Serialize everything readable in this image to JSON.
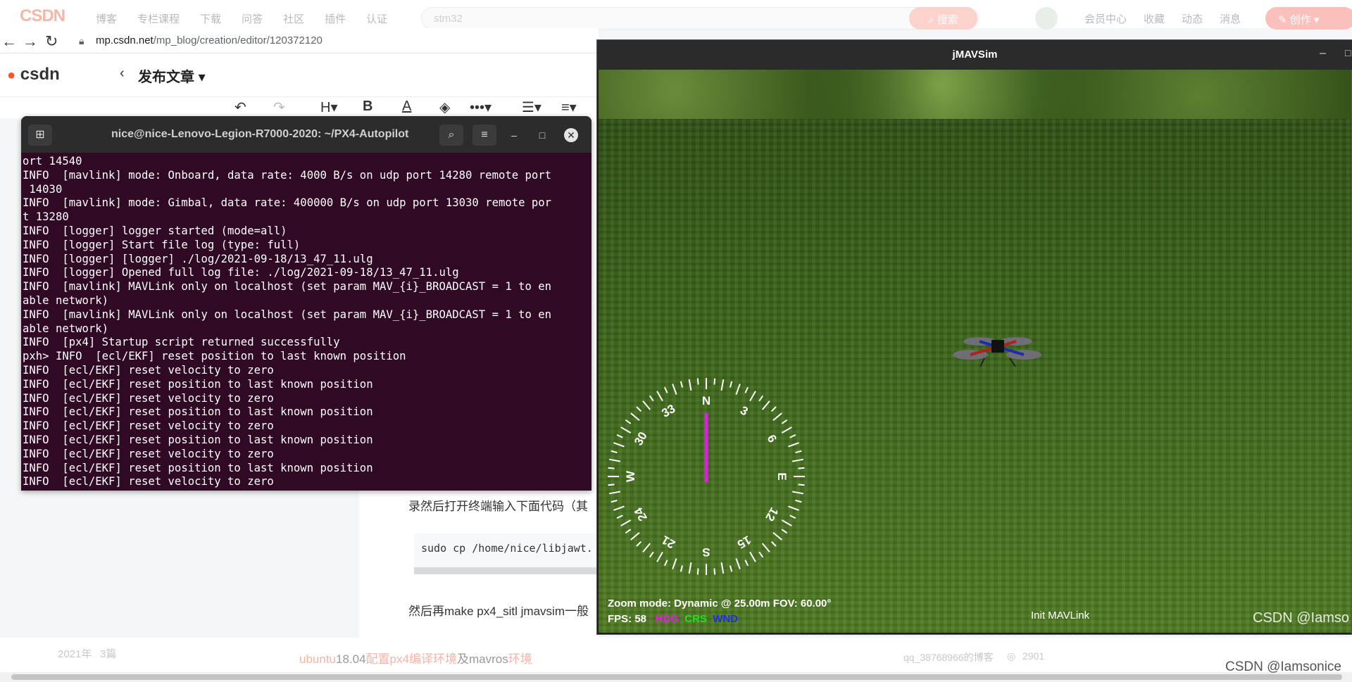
{
  "csdn_top": {
    "logo": "CSDN",
    "nav": [
      "博客",
      "专栏课程",
      "下载",
      "问答",
      "社区",
      "插件",
      "认证"
    ],
    "search_value": "stm32",
    "search_button": "搜索",
    "right": [
      "会员中心",
      "收藏",
      "动态",
      "消息"
    ],
    "create": "创作"
  },
  "browser": {
    "url_host": "mp.csdn.net",
    "url_path": "/mp_blog/creation/editor/120372120"
  },
  "editor": {
    "logo_c": "c",
    "logo_rest": "sdn",
    "publish_title": "发布文章",
    "text_line1": "录然后打开终端输入下面代码（其",
    "code_line": "sudo cp /home/nice/libjawt.",
    "text_line2": "然后再make px4_sitl jmavsim一般"
  },
  "terminal": {
    "title": "nice@nice-Lenovo-Legion-R7000-2020: ~/PX4-Autopilot",
    "lines": [
      "ort 14540",
      "INFO  [mavlink] mode: Onboard, data rate: 4000 B/s on udp port 14280 remote port",
      " 14030",
      "INFO  [mavlink] mode: Gimbal, data rate: 400000 B/s on udp port 13030 remote por",
      "t 13280",
      "INFO  [logger] logger started (mode=all)",
      "INFO  [logger] Start file log (type: full)",
      "INFO  [logger] [logger] ./log/2021-09-18/13_47_11.ulg",
      "INFO  [logger] Opened full log file: ./log/2021-09-18/13_47_11.ulg",
      "INFO  [mavlink] MAVLink only on localhost (set param MAV_{i}_BROADCAST = 1 to en",
      "able network)",
      "INFO  [mavlink] MAVLink only on localhost (set param MAV_{i}_BROADCAST = 1 to en",
      "able network)",
      "INFO  [px4] Startup script returned successfully",
      "pxh> INFO  [ecl/EKF] reset position to last known position",
      "INFO  [ecl/EKF] reset velocity to zero",
      "INFO  [ecl/EKF] reset position to last known position",
      "INFO  [ecl/EKF] reset velocity to zero",
      "INFO  [ecl/EKF] reset position to last known position",
      "INFO  [ecl/EKF] reset velocity to zero",
      "INFO  [ecl/EKF] reset position to last known position",
      "INFO  [ecl/EKF] reset velocity to zero",
      "INFO  [ecl/EKF] reset position to last known position",
      "INFO  [ecl/EKF] reset velocity to zero"
    ]
  },
  "jmavsim": {
    "title": "jMAVSim",
    "zoom_text": "Zoom mode: Dynamic @ 25.00m   FOV: 60.00°",
    "fps": "FPS: 58",
    "hdg": "HDG",
    "crs": "CRS",
    "wnd": "WND",
    "status": "Init MAVLink",
    "compass_labels": [
      "33",
      "3",
      "30",
      "6",
      "W",
      "E",
      "24",
      "12",
      "21",
      "15",
      "S",
      "N"
    ]
  },
  "footer": {
    "date": "2021年",
    "count": "3篇",
    "link_a": "ubuntu",
    "link_b": "18.04",
    "link_c": "配置px4编译环境",
    "link_d": "及",
    "link_e": "mavros",
    "link_f": "环境",
    "user": "qq_38768966的博客",
    "views": "2901"
  },
  "watermark": "CSDN @Iamsonice",
  "watermark_top": "CSDN @Iamso"
}
